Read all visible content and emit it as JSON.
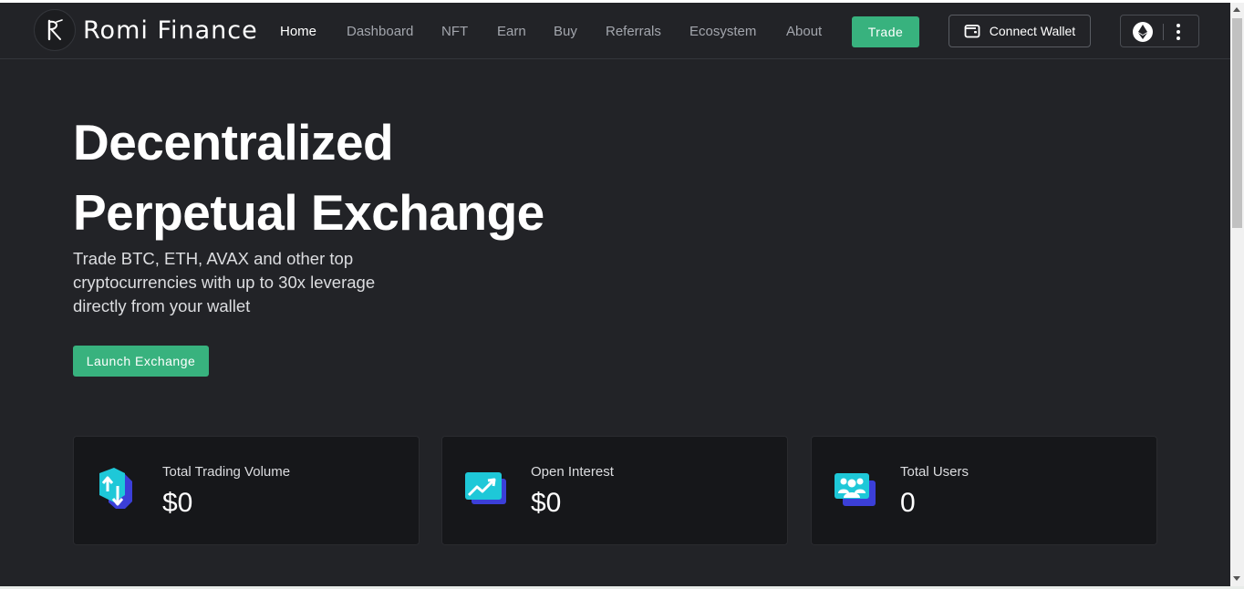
{
  "brand": {
    "name": "Romi Finance"
  },
  "nav": {
    "items": [
      {
        "label": "Home",
        "active": true
      },
      {
        "label": "Dashboard"
      },
      {
        "label": "NFT"
      },
      {
        "label": "Earn"
      },
      {
        "label": "Buy"
      },
      {
        "label": "Referrals"
      },
      {
        "label": "Ecosystem"
      },
      {
        "label": "About"
      }
    ],
    "trade_label": "Trade",
    "connect_wallet_label": "Connect Wallet",
    "network_icon": "ethereum-icon"
  },
  "hero": {
    "title_line1": "Decentralized",
    "title_line2": "Perpetual Exchange",
    "subtitle": "Trade BTC, ETH, AVAX and other top cryptocurrencies with up to 30x leverage directly from your wallet",
    "cta_label": "Launch Exchange"
  },
  "stats": [
    {
      "label": "Total Trading Volume",
      "value": "$0",
      "icon": "trading-volume-icon"
    },
    {
      "label": "Open Interest",
      "value": "$0",
      "icon": "open-interest-icon"
    },
    {
      "label": "Total Users",
      "value": "0",
      "icon": "users-icon"
    }
  ],
  "colors": {
    "background": "#222327",
    "accent": "#38b27e",
    "card": "#16171a",
    "icon_cyan": "#1ec8d8",
    "icon_indigo": "#3b3fd8"
  }
}
